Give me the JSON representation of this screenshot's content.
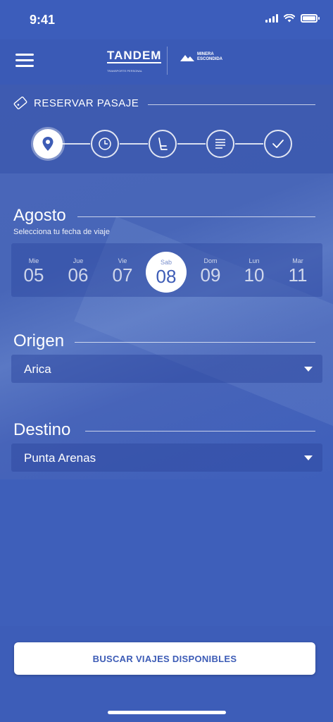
{
  "status_bar": {
    "time": "9:41"
  },
  "header": {
    "logo_text": "TANDEM",
    "logo_tagline": "TRANSPORTE PERSONAL",
    "partner_logo_line1": "MINERA",
    "partner_logo_line2": "ESCONDIDA"
  },
  "booking": {
    "title": "RESERVAR PASAJE",
    "steps": [
      {
        "icon": "location-pin-icon",
        "active": true
      },
      {
        "icon": "clock-icon",
        "active": false
      },
      {
        "icon": "seat-icon",
        "active": false
      },
      {
        "icon": "list-icon",
        "active": false
      },
      {
        "icon": "checkmark-icon",
        "active": false
      }
    ]
  },
  "date_picker": {
    "month": "Agosto",
    "subtitle": "Selecciona tu fecha de viaje",
    "days": [
      {
        "dow": "Mie",
        "num": "05"
      },
      {
        "dow": "Jue",
        "num": "06"
      },
      {
        "dow": "Vie",
        "num": "07"
      },
      {
        "dow": "Sab",
        "num": "08",
        "selected": true
      },
      {
        "dow": "Dom",
        "num": "09"
      },
      {
        "dow": "Lun",
        "num": "10"
      },
      {
        "dow": "Mar",
        "num": "11"
      }
    ]
  },
  "origin": {
    "label": "Origen",
    "value": "Arica"
  },
  "destination": {
    "label": "Destino",
    "value": "Punta Arenas"
  },
  "search_button": {
    "label": "BUSCAR VIAJES DISPONIBLES"
  },
  "colors": {
    "primary": "#3e5fba",
    "white": "#ffffff"
  }
}
